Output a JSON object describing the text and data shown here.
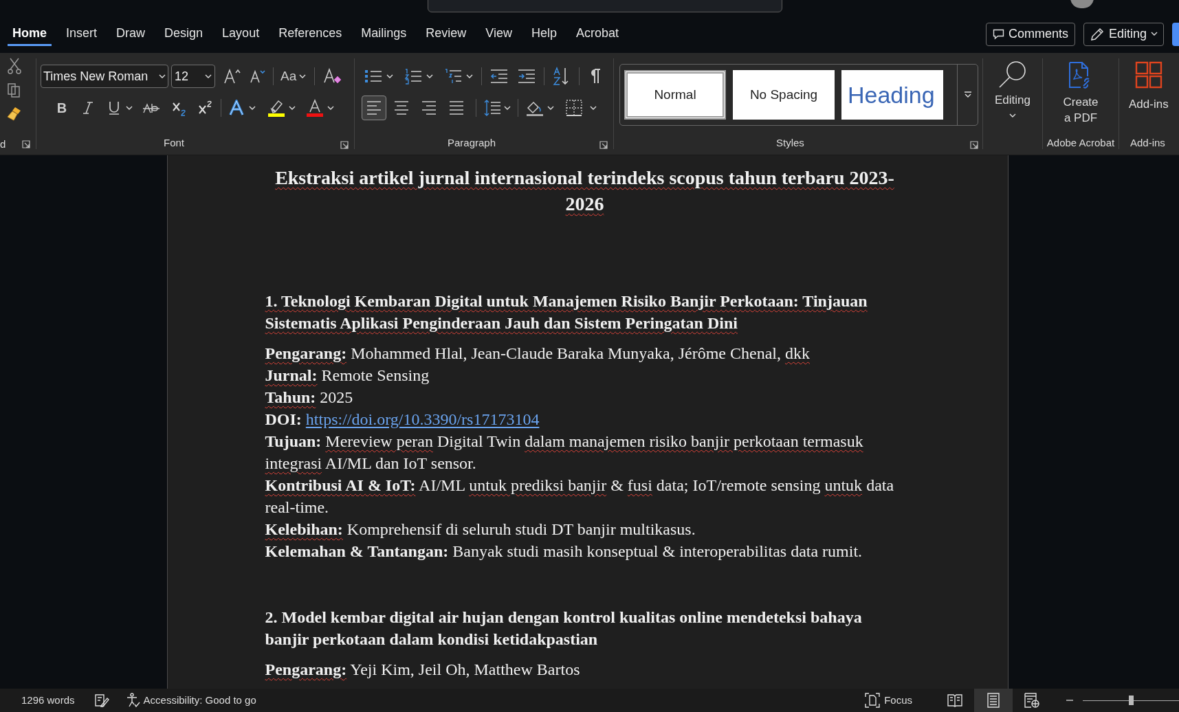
{
  "tabs": [
    {
      "label": "Home",
      "selected": true
    },
    {
      "label": "Insert",
      "selected": false
    },
    {
      "label": "Draw",
      "selected": false
    },
    {
      "label": "Design",
      "selected": false
    },
    {
      "label": "Layout",
      "selected": false
    },
    {
      "label": "References",
      "selected": false
    },
    {
      "label": "Mailings",
      "selected": false
    },
    {
      "label": "Review",
      "selected": false
    },
    {
      "label": "View",
      "selected": false
    },
    {
      "label": "Help",
      "selected": false
    },
    {
      "label": "Acrobat",
      "selected": false
    }
  ],
  "header_buttons": {
    "comments": "Comments",
    "editing": "Editing"
  },
  "ribbon": {
    "clipboard_label": "d",
    "font": {
      "bold": "B",
      "family": "Times New Roman",
      "size": "12",
      "label": "Font",
      "change_case": "Aa"
    },
    "paragraph": {
      "label": "Paragraph",
      "alignments": [
        {
          "selected": true
        },
        {
          "selected": false
        },
        {
          "selected": false
        },
        {
          "selected": false
        }
      ]
    },
    "styles": {
      "label": "Styles",
      "items": [
        {
          "label": "Normal",
          "kind": "normal",
          "selected": true
        },
        {
          "label": "No Spacing",
          "kind": "plain",
          "selected": false
        },
        {
          "label": "Heading",
          "kind": "heading",
          "selected": false
        }
      ]
    },
    "editing": {
      "label": "Editing"
    },
    "acrobat": {
      "button": "Create a PDF",
      "label": "Adobe Acrobat"
    },
    "addins": {
      "button": "Add-ins",
      "label": "Add-ins"
    }
  },
  "document": {
    "title": {
      "text": "Ekstraksi artikel jurnal internasional terindeks scopus tahun terbaru 2023-2026",
      "spell": true
    },
    "articles": [
      {
        "heading": "1. Teknologi Kembaran Digital untuk Manajemen Risiko Banjir Perkotaan: Tinjauan Sistematis Aplikasi Penginderaan Jauh dan Sistem Peringatan Dini",
        "heading_spell": true,
        "fields": [
          {
            "label": "Pengarang:",
            "label_spell": true,
            "runs": [
              {
                "t": " Mohammed Hlal, Jean-Claude Baraka Munyaka, Jérôme Chenal, "
              },
              {
                "t": "dkk",
                "spell": true
              }
            ]
          },
          {
            "label": "Jurnal:",
            "label_spell": true,
            "runs": [
              {
                "t": " Remote Sensing"
              }
            ]
          },
          {
            "label": "Tahun:",
            "label_spell": true,
            "runs": [
              {
                "t": " 2025"
              }
            ]
          },
          {
            "label": "DOI:",
            "label_spell": false,
            "runs": [
              {
                "t": "https://doi.org/10.3390/rs17173104",
                "kind": "link"
              }
            ]
          },
          {
            "label": "Tujuan:",
            "label_spell": false,
            "runs": [
              {
                "t": "Mereview peran",
                "spell": true
              },
              {
                "t": " Digital Twin "
              },
              {
                "t": "dalam manajemen risiko banjir perkotaan termasuk integrasi",
                "spell": true
              },
              {
                "t": " AI/ML dan IoT sensor."
              }
            ]
          },
          {
            "label": "Kontribusi AI & IoT:",
            "label_spell": true,
            "runs": [
              {
                "t": " AI/ML "
              },
              {
                "t": "untuk prediksi banjir",
                "spell": true
              },
              {
                "t": " & "
              },
              {
                "t": "fusi",
                "spell": true
              },
              {
                "t": " data; IoT/remote sensing "
              },
              {
                "t": "untuk",
                "spell": true
              },
              {
                "t": " data real-time."
              }
            ]
          },
          {
            "label": "Kelebihan:",
            "label_spell": true,
            "runs": [
              {
                "t": " Komprehensif di seluruh studi DT banjir multikasus."
              }
            ]
          },
          {
            "label": "Kelemahan & Tantangan:",
            "label_spell": false,
            "runs": [
              {
                "t": " Banyak studi masih konseptual & interoperabilitas data rumit."
              }
            ]
          }
        ]
      },
      {
        "heading": "2. Model kembar digital air hujan dengan kontrol kualitas online mendeteksi bahaya banjir perkotaan dalam kondisi ketidakpastian",
        "heading_spell": false,
        "fields": [
          {
            "label": "Pengarang:",
            "label_spell": true,
            "runs": [
              {
                "t": " Yeji Kim, Jeil Oh, Matthew Bartos"
              }
            ]
          }
        ]
      }
    ]
  },
  "status_bar": {
    "words": "1296 words",
    "accessibility": "Accessibility: Good to go",
    "focus": "Focus",
    "views": [
      {
        "kind": "read",
        "selected": false
      },
      {
        "kind": "print",
        "selected": true
      },
      {
        "kind": "web",
        "selected": false
      }
    ],
    "zoom": {
      "level": 0.5
    }
  }
}
